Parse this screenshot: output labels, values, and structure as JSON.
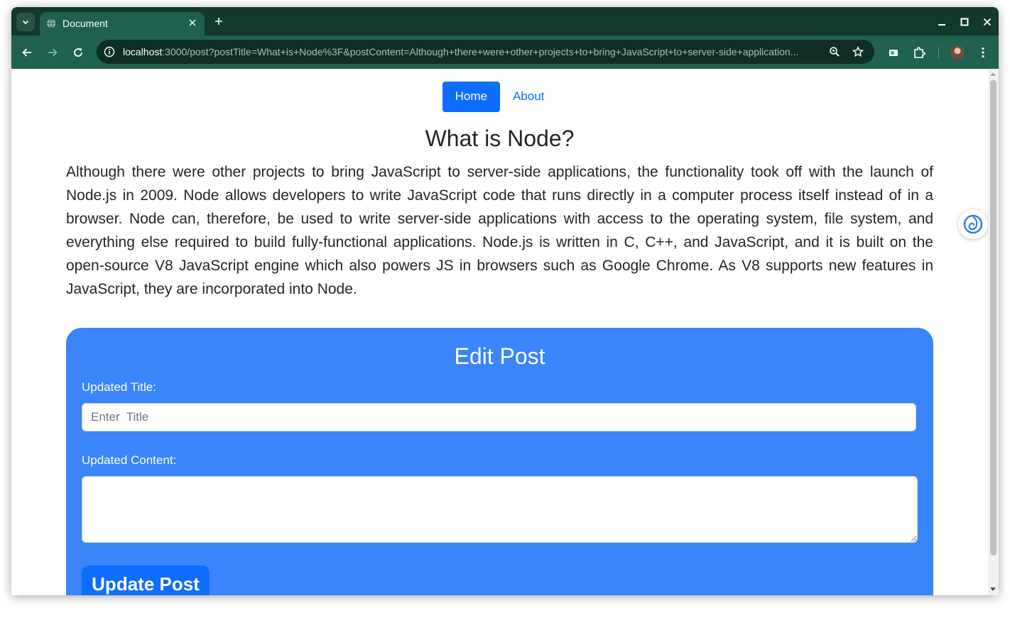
{
  "browser": {
    "tab_title": "Document",
    "url_host": "localhost",
    "url_rest": ":3000/post?postTitle=What+is+Node%3F&postContent=Although+there+were+other+projects+to+bring+JavaScript+to+server-side+application..."
  },
  "nav": {
    "home_label": "Home",
    "about_label": "About"
  },
  "post": {
    "title": "What is Node?",
    "content": "Although there were other projects to bring JavaScript to server-side applications, the functionality took off with the launch of Node.js in 2009. Node allows developers to write JavaScript code that runs directly in a computer process itself instead of in a browser. Node can, therefore, be used to write server-side applications with access to the operating system, file system, and everything else required to build fully-functional applications. Node.js is written in C, C++, and JavaScript, and it is built on the open-source V8 JavaScript engine which also powers JS in browsers such as Google Chrome. As V8 supports new features in JavaScript, they are incorporated into Node."
  },
  "edit_form": {
    "heading": "Edit Post",
    "title_label": "Updated Title:",
    "title_placeholder": "Enter  Title",
    "title_value": "",
    "content_label": "Updated Content:",
    "content_value": "",
    "submit_label": "Update Post"
  },
  "colors": {
    "tab_strip": "#12392e",
    "toolbar": "#20604f",
    "primary": "#0d6efd",
    "card": "#3a84fc"
  },
  "icons": [
    "tab-search-icon",
    "globe-icon",
    "close-icon",
    "plus-icon",
    "minimize-icon",
    "maximize-icon",
    "back-icon",
    "forward-icon",
    "reload-icon",
    "info-icon",
    "zoom-icon",
    "star-icon",
    "extension-icon",
    "puzzle-icon",
    "profile-avatar",
    "menu-icon",
    "assistant-extension-icon"
  ]
}
